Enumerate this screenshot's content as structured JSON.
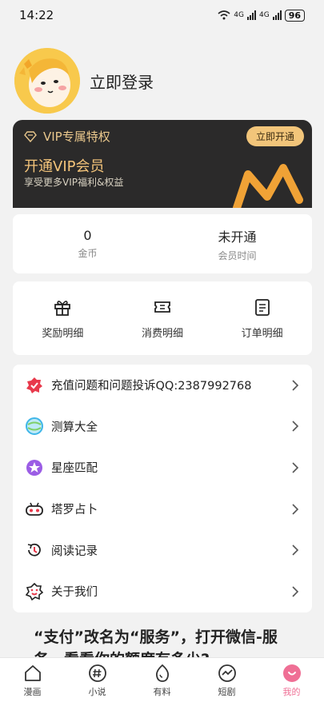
{
  "status": {
    "time": "14:22",
    "net1": "4G",
    "net2": "4G",
    "battery": "96"
  },
  "profile": {
    "login": "立即登录"
  },
  "vip": {
    "title": "VIP专属特权",
    "button": "立即开通",
    "main": "开通VIP会员",
    "sub": "享受更多VIP福利&权益",
    "accent": "#f2c57a"
  },
  "stats": [
    {
      "value": "0",
      "label": "金币"
    },
    {
      "value": "未开通",
      "label": "会员时间"
    }
  ],
  "actions": [
    {
      "label": "奖励明细",
      "icon": "gift-icon"
    },
    {
      "label": "消费明细",
      "icon": "ticket-icon"
    },
    {
      "label": "订单明细",
      "icon": "order-list-icon"
    }
  ],
  "menu": [
    {
      "label": "充值问题和问题投诉QQ:2387992768",
      "icon": "complaint-icon",
      "color": "#e8394b"
    },
    {
      "label": "测算大全",
      "icon": "fortune-globe-icon",
      "color": "#3fb6e8"
    },
    {
      "label": "星座匹配",
      "icon": "star-icon",
      "color": "#9b5de5"
    },
    {
      "label": "塔罗占卜",
      "icon": "tarot-icon",
      "color": "#e8394b"
    },
    {
      "label": "阅读记录",
      "icon": "history-icon",
      "color": "#e8394b"
    },
    {
      "label": "关于我们",
      "icon": "about-icon",
      "color": "#e8394b"
    }
  ],
  "article": {
    "text": "“支付”改名为“服务”，打开微信-服务，看看你的额度有多少?"
  },
  "tabs": [
    {
      "label": "漫画",
      "icon": "home-icon"
    },
    {
      "label": "小说",
      "icon": "hashtag-icon"
    },
    {
      "label": "有料",
      "icon": "egg-icon"
    },
    {
      "label": "短剧",
      "icon": "trend-icon"
    },
    {
      "label": "我的",
      "icon": "me-icon"
    }
  ],
  "colors": {
    "active_tab": "#ef6f95",
    "vip_bg": "#2b2a2a"
  }
}
